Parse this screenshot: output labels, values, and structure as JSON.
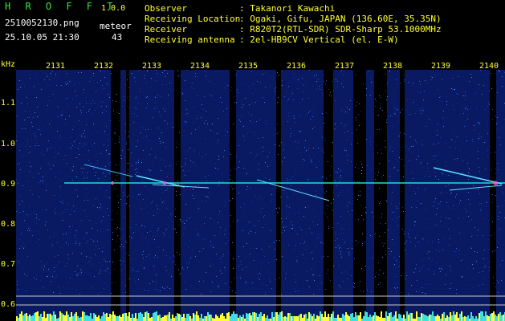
{
  "app": {
    "name": "H R O F F T",
    "version": "1.0.0"
  },
  "file": {
    "filename": "2510052130.png",
    "datetime": "25.10.05 21:30",
    "meteor_label": "meteor",
    "meteor_count": "43"
  },
  "station": {
    "rows": [
      {
        "label": "Observer",
        "value": ": Takanori Kawachi"
      },
      {
        "label": "Receiving Location",
        "value": ": Ogaki, Gifu, JAPAN (136.60E, 35.35N)"
      },
      {
        "label": "Receiver",
        "value": ": R820T2(RTL-SDR) SDR-Sharp 53.1000MHz"
      },
      {
        "label": "Receiving antenna",
        "value": ": 2el-HB9CV Vertical (el. E-W)"
      }
    ]
  },
  "axis": {
    "unit": "kHz",
    "y_ticks": [
      "1.1",
      "1.0",
      "0.9",
      "0.8",
      "0.7",
      "0.6"
    ],
    "x_ticks": [
      "2131",
      "2132",
      "2133",
      "2134",
      "2135",
      "2136",
      "2137",
      "2138",
      "2139",
      "2140"
    ]
  },
  "colors": {
    "background": "#000000",
    "spectrogram_bg": "#091a63",
    "header_text": "#ffffff",
    "title": "#39e639",
    "accent": "#ffff33",
    "carrier": "#2ad8d8",
    "meteor": "#ff4fd6"
  }
}
